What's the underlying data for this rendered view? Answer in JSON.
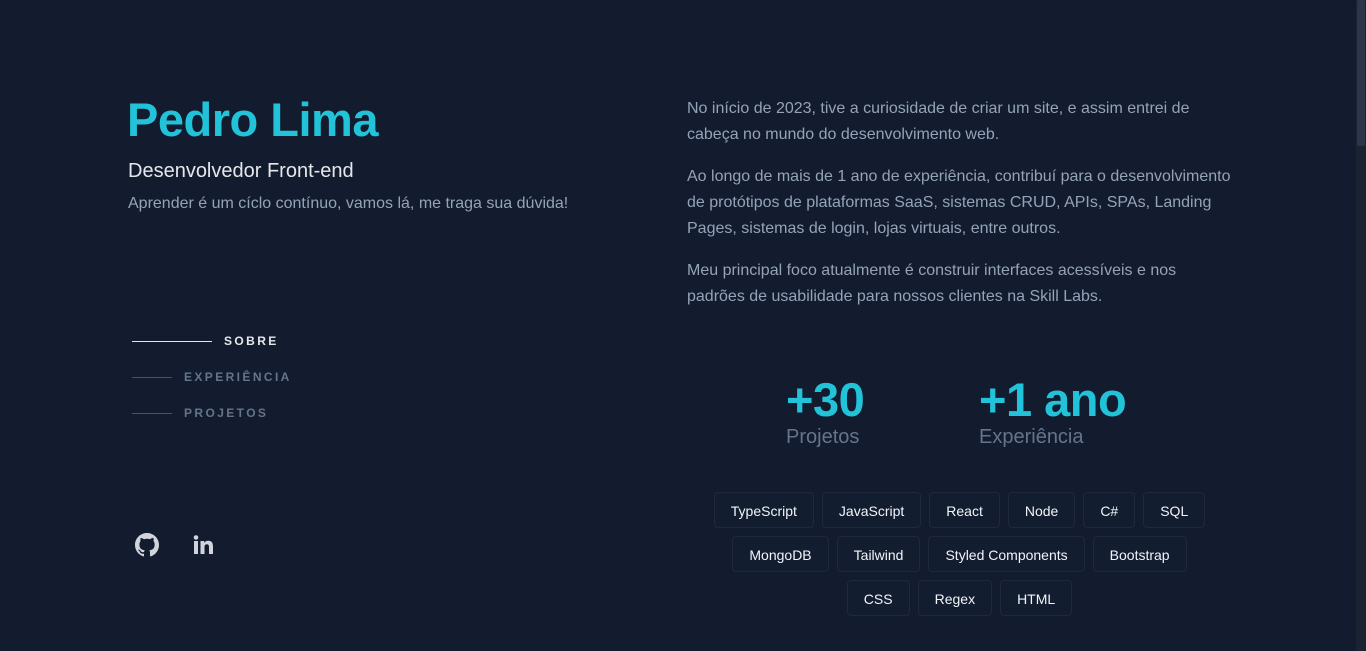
{
  "profile": {
    "name": "Pedro Lima",
    "role": "Desenvolvedor Front-end",
    "tagline": "Aprender é um cíclo contínuo, vamos lá, me traga sua dúvida!"
  },
  "nav": {
    "items": [
      {
        "label": "SOBRE",
        "active": true
      },
      {
        "label": "EXPERIÊNCIA",
        "active": false
      },
      {
        "label": "PROJETOS",
        "active": false
      }
    ]
  },
  "socials": {
    "github_icon": "github-icon",
    "linkedin_icon": "linkedin-icon"
  },
  "about": {
    "paragraphs": [
      "No início de 2023, tive a curiosidade de criar um site, e assim entrei de cabeça no mundo do desenvolvimento web.",
      "Ao longo de mais de 1 ano de experiência, contribuí para o desenvolvimento de protótipos de plataformas SaaS, sistemas CRUD, APIs, SPAs, Landing Pages, sistemas de login, lojas virtuais, entre outros.",
      "Meu principal foco atualmente é construir interfaces acessíveis e nos padrões de usabilidade para nossos clientes na Skill Labs."
    ]
  },
  "stats": [
    {
      "value": "+30",
      "label": "Projetos"
    },
    {
      "value": "+1 ano",
      "label": "Experiência"
    }
  ],
  "skills": {
    "rows": [
      [
        "TypeScript",
        "JavaScript",
        "React",
        "Node",
        "C#",
        "SQL"
      ],
      [
        "MongoDB",
        "Tailwind",
        "Styled Components",
        "Bootstrap"
      ],
      [
        "CSS",
        "Regex",
        "HTML"
      ]
    ]
  },
  "colors": {
    "background": "#131c2f",
    "accent": "#22c3d9",
    "text_muted": "#94a3b8",
    "text_light": "#e5e7eb"
  }
}
